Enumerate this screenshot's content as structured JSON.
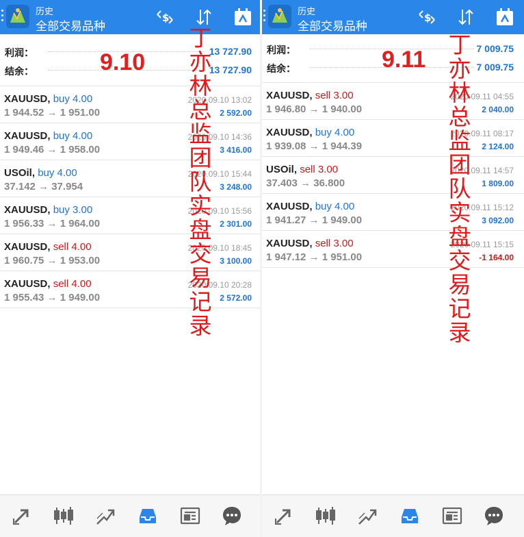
{
  "header": {
    "title": "历史",
    "subtitle": "全部交易品种"
  },
  "labels": {
    "profit": "利润：",
    "balance": "结余："
  },
  "overlay_text": "丁亦林总监团队实盘交易记录",
  "colors": {
    "header_blue": "#2a86e8",
    "buy_blue": "#1e73d6",
    "sell_red": "#d01818",
    "overlay_red": "#e01a1a"
  },
  "icons": {
    "header": [
      "currency-exchange-icon",
      "sort-icon",
      "calendar-icon"
    ],
    "bottom_nav": [
      "quotes-icon",
      "chart-candlestick-icon",
      "trade-icon",
      "history-icon",
      "news-icon",
      "chat-icon"
    ]
  },
  "left": {
    "date_label": "9.10",
    "profit": "13 727.90",
    "balance": "13 727.90",
    "trades": [
      {
        "symbol": "XAUUSD,",
        "side": "buy 4.00",
        "type": "buy",
        "prices": "1 944.52 → 1 951.00",
        "time": "2020.09.10 13:02",
        "profit": "2 592.00"
      },
      {
        "symbol": "XAUUSD,",
        "side": "buy 4.00",
        "type": "buy",
        "prices": "1 949.46 → 1 958.00",
        "time": "2020.09.10 14:36",
        "profit": "3 416.00"
      },
      {
        "symbol": "USOil,",
        "side": "buy 4.00",
        "type": "buy",
        "prices": "37.142 → 37.954",
        "time": "2020.09.10 15:44",
        "profit": "3 248.00"
      },
      {
        "symbol": "XAUUSD,",
        "side": "buy 3.00",
        "type": "buy",
        "prices": "1 956.33 → 1 964.00",
        "time": "2020.09.10 15:56",
        "profit": "2 301.00"
      },
      {
        "symbol": "XAUUSD,",
        "side": "sell 4.00",
        "type": "sell",
        "prices": "1 960.75 → 1 953.00",
        "time": "2020.09.10 18:45",
        "profit": "3 100.00"
      },
      {
        "symbol": "XAUUSD,",
        "side": "sell 4.00",
        "type": "sell",
        "prices": "1 955.43 → 1 949.00",
        "time": "2020.09.10 20:28",
        "profit": "2 572.00"
      }
    ]
  },
  "right": {
    "date_label": "9.11",
    "profit": "7 009.75",
    "balance": "7 009.75",
    "trades": [
      {
        "symbol": "XAUUSD,",
        "side": "sell 3.00",
        "type": "sell",
        "prices": "1 946.80 → 1 940.00",
        "time": "2020.09.11 04:55",
        "profit": "2 040.00"
      },
      {
        "symbol": "XAUUSD,",
        "side": "buy 4.00",
        "type": "buy",
        "prices": "1 939.08 → 1 944.39",
        "time": "2020.09.11 08:17",
        "profit": "2 124.00"
      },
      {
        "symbol": "USOil,",
        "side": "sell 3.00",
        "type": "sell",
        "prices": "37.403 → 36.800",
        "time": "2020.09.11 14:57",
        "profit": "1 809.00"
      },
      {
        "symbol": "XAUUSD,",
        "side": "buy 4.00",
        "type": "buy",
        "prices": "1 941.27 → 1 949.00",
        "time": "2020.09.11 15:12",
        "profit": "3 092.00"
      },
      {
        "symbol": "XAUUSD,",
        "side": "sell 3.00",
        "type": "sell",
        "prices": "1 947.12 → 1 951.00",
        "time": "2020.09.11 15:15",
        "profit": "-1 164.00"
      }
    ]
  }
}
